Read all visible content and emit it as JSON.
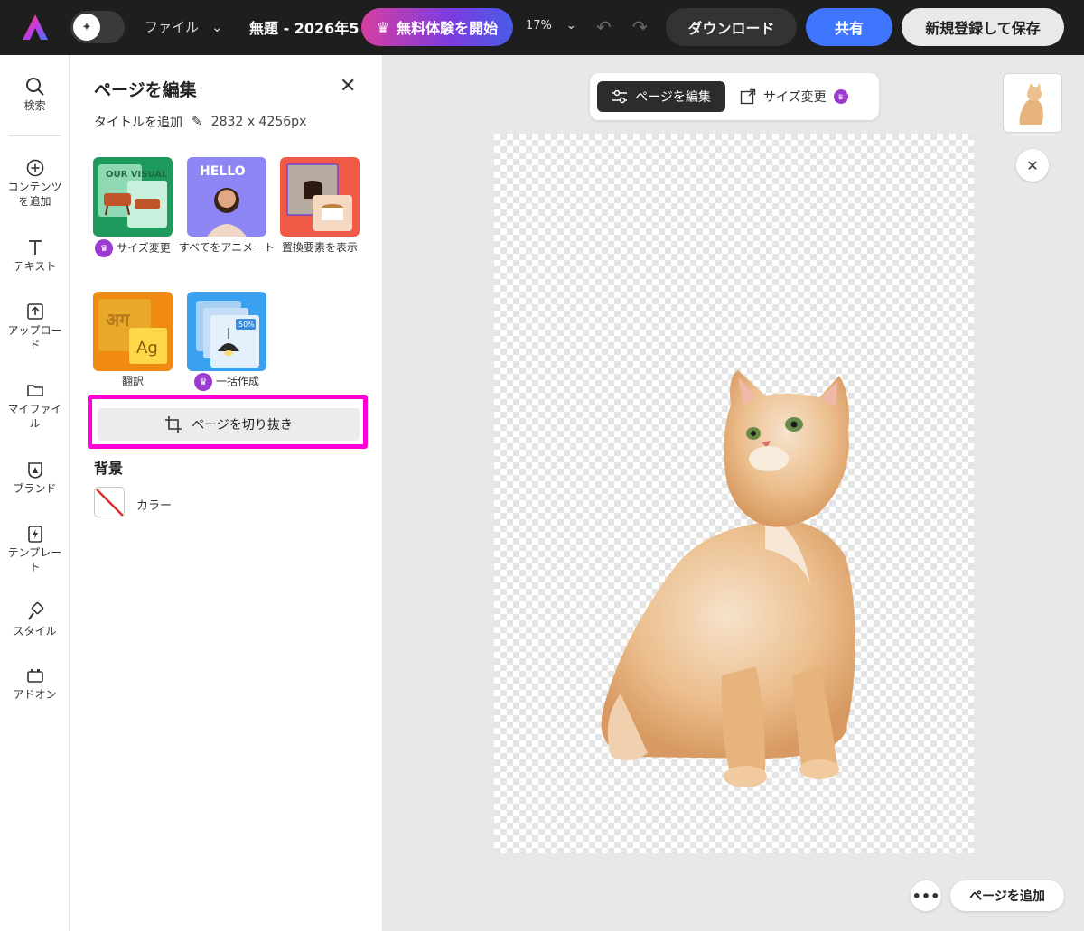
{
  "topbar": {
    "file_menu": "ファイル",
    "doc_title": "無題 - 2026年5",
    "trial_button": "無料体験を開始",
    "zoom": "17%",
    "download_button": "ダウンロード",
    "share_button": "共有",
    "save_button": "新規登録して保存"
  },
  "rail": {
    "items": [
      {
        "label": "検索",
        "icon": "search-icon"
      },
      {
        "label": "コンテンツを追加",
        "icon": "add-circle-icon"
      },
      {
        "label": "テキスト",
        "icon": "text-icon"
      },
      {
        "label": "アップロード",
        "icon": "upload-icon"
      },
      {
        "label": "マイファイル",
        "icon": "folder-icon"
      },
      {
        "label": "ブランド",
        "icon": "brand-icon"
      },
      {
        "label": "テンプレート",
        "icon": "template-icon"
      },
      {
        "label": "スタイル",
        "icon": "style-icon"
      },
      {
        "label": "アドオン",
        "icon": "addon-icon"
      }
    ]
  },
  "panel": {
    "title": "ページを編集",
    "add_title": "タイトルを追加",
    "dimensions": "2832 x 4256px",
    "tiles": [
      {
        "label": "サイズ変更",
        "premium": true,
        "thumb_text": "OUR VISUAL"
      },
      {
        "label": "すべてをアニメート",
        "premium": false,
        "thumb_text": "HELLO"
      },
      {
        "label": "置換要素を表示",
        "premium": false
      },
      {
        "label": "翻訳",
        "premium": false,
        "thumb_text_1": "अग",
        "thumb_text_2": "Ag"
      },
      {
        "label": "一括作成",
        "premium": true,
        "thumb_text": "50%"
      }
    ],
    "crop_button": "ページを切り抜き",
    "background_title": "背景",
    "color_label": "カラー"
  },
  "canvas_area": {
    "edit_page_button": "ページを編集",
    "resize_button": "サイズ変更",
    "more_button": "•••",
    "add_page_button": "ページを追加"
  },
  "colors": {
    "accent_blue": "#3f76ff",
    "premium_purple": "#9b3bcf",
    "highlight_magenta": "#ff00d8"
  }
}
